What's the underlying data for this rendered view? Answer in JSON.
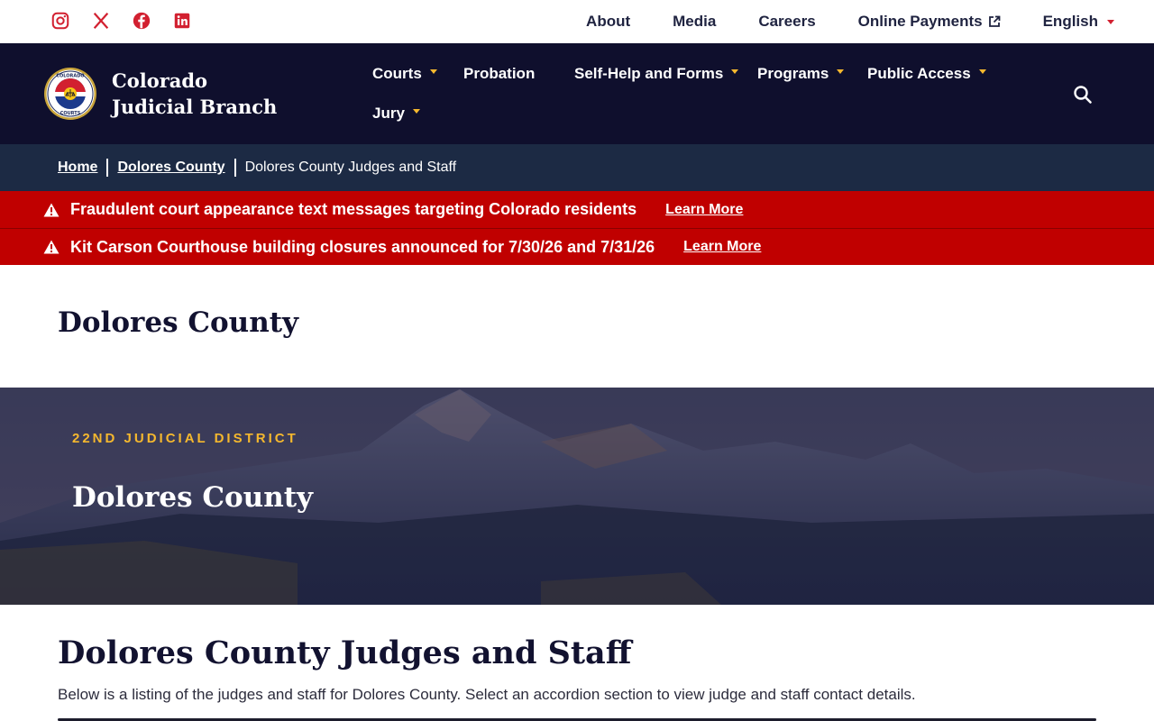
{
  "social": [
    {
      "name": "instagram-icon",
      "color": "#d22030"
    },
    {
      "name": "x-twitter-icon",
      "color": "#d22030"
    },
    {
      "name": "facebook-icon",
      "color": "#d22030"
    },
    {
      "name": "linkedin-icon",
      "color": "#d22030"
    }
  ],
  "utility_links": {
    "about": "About",
    "media": "Media",
    "careers": "Careers",
    "online_payments": "Online Payments",
    "language": "English"
  },
  "brand": {
    "name": "Colorado Judicial Branch",
    "seal_text_top": "COLORADO",
    "seal_text_bottom": "COURTS"
  },
  "nav": {
    "courts": "Courts",
    "probation": "Probation",
    "self_help": "Self-Help and Forms",
    "programs": "Programs",
    "public_access": "Public Access",
    "jury": "Jury"
  },
  "breadcrumb": {
    "home": "Home",
    "county": "Dolores County",
    "current": "Dolores County Judges and Staff"
  },
  "alerts": [
    {
      "message": "Fraudulent court appearance text messages targeting Colorado residents",
      "link": "Learn More"
    },
    {
      "message": "Kit Carson Courthouse building closures announced for 7/30/26 and 7/31/26",
      "link": "Learn More"
    }
  ],
  "page_title": "Dolores County",
  "hero": {
    "eyebrow": "22ND JUDICIAL DISTRICT",
    "title": "Dolores County"
  },
  "section": {
    "title": "Dolores County Judges and Staff",
    "description": "Below is a listing of the judges and staff for Dolores County. Select an accordion section to view judge and staff contact details."
  },
  "colors": {
    "nav_bg": "#0f0f2d",
    "breadcrumb_bg": "#1c2a44",
    "alert_bg": "#c00000",
    "accent_gold": "#f5b82e",
    "accent_red": "#d22030"
  }
}
